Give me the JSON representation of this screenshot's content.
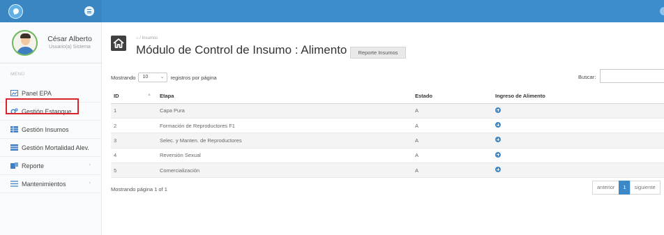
{
  "user": {
    "name": "César Alberto",
    "role": "Usuario(a) Sistema"
  },
  "sidebar": {
    "menu_label": "MENÚ",
    "items": [
      {
        "label": "Panel EPA",
        "icon": "dashboard-icon",
        "has_chevron": false
      },
      {
        "label": "Gestión Estanque",
        "icon": "gears-icon",
        "has_chevron": false
      },
      {
        "label": "Gestión Insumos",
        "icon": "table-icon",
        "has_chevron": false
      },
      {
        "label": "Gestión Mortalidad Alev.",
        "icon": "list-icon",
        "has_chevron": false
      },
      {
        "label": "Reporte",
        "icon": "report-icon",
        "has_chevron": true
      },
      {
        "label": "Mantenimientos",
        "icon": "menu-icon",
        "has_chevron": true
      }
    ],
    "chevron": "‹"
  },
  "header": {
    "breadcrumb_home": "⌂",
    "breadcrumb": "/ Insumos",
    "title": "Módulo de Control de Insumo : Alimento",
    "report_button": "Reporte Insumos"
  },
  "table_controls": {
    "showing_prefix": "Mostrando",
    "page_length": "10",
    "showing_suffix": "registros por página",
    "search_label": "Buscar:",
    "search_value": ""
  },
  "table": {
    "columns": [
      "ID",
      "Etapa",
      "Estado",
      "Ingreso de Alimento"
    ],
    "rows": [
      {
        "id": "1",
        "etapa": "Capa Pura",
        "estado": "A"
      },
      {
        "id": "2",
        "etapa": "Formación de Reproductores F1",
        "estado": "A"
      },
      {
        "id": "3",
        "etapa": "Selec. y Manten. de Reproductores",
        "estado": "A"
      },
      {
        "id": "4",
        "etapa": "Reversión Sexual",
        "estado": "A"
      },
      {
        "id": "5",
        "etapa": "Comercialización",
        "estado": "A"
      }
    ]
  },
  "footer": {
    "info": "Mostrando página 1 of 1",
    "prev": "anterior",
    "current_page": "1",
    "next": "siguiente"
  },
  "colors": {
    "topbar": "#3c8dcc",
    "accent": "#3c88c9",
    "highlight_border": "#d9242b"
  }
}
